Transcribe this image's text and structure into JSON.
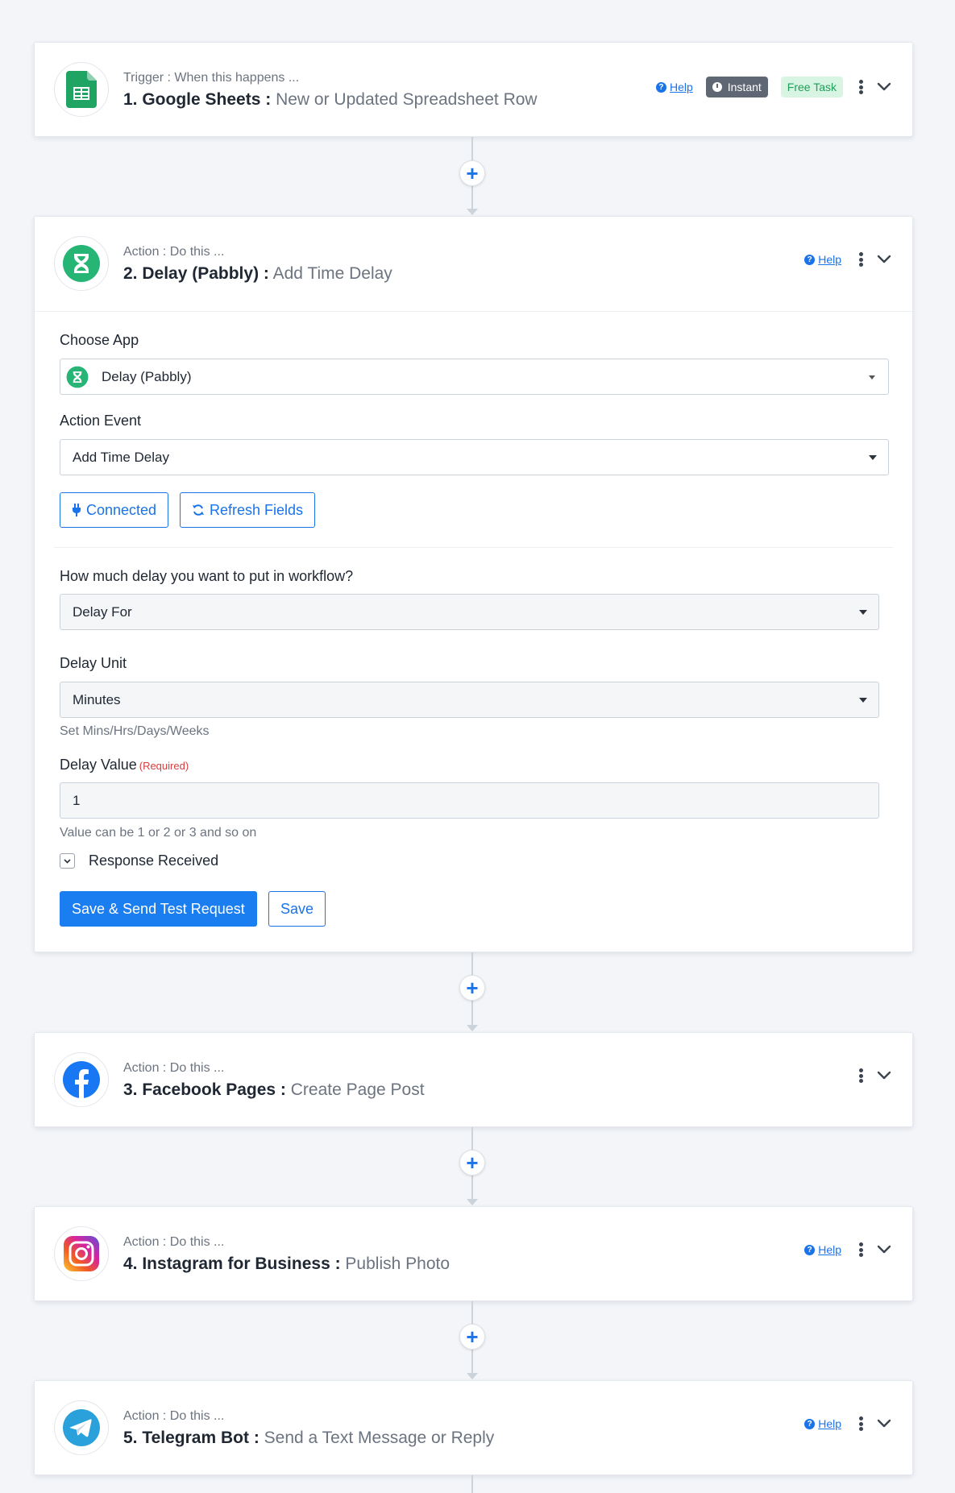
{
  "steps": [
    {
      "subtitle": "Trigger : When this happens ...",
      "app": "1. Google Sheets :",
      "event": "New or Updated Spreadsheet Row",
      "logo": "google-sheets-icon",
      "help": "Help",
      "instant": "Instant",
      "free_task": "Free Task"
    },
    {
      "subtitle": "Action : Do this ...",
      "app": "2. Delay (Pabbly) :",
      "event": "Add Time Delay",
      "logo": "hourglass-icon",
      "help": "Help"
    },
    {
      "subtitle": "Action : Do this ...",
      "app": "3. Facebook Pages :",
      "event": "Create Page Post",
      "logo": "facebook-icon"
    },
    {
      "subtitle": "Action : Do this ...",
      "app": "4. Instagram for Business :",
      "event": "Publish Photo",
      "logo": "instagram-icon",
      "help": "Help"
    },
    {
      "subtitle": "Action : Do this ...",
      "app": "5. Telegram Bot :",
      "event": "Send a Text Message or Reply",
      "logo": "telegram-icon",
      "help": "Help"
    }
  ],
  "delay_form": {
    "choose_app_label": "Choose App",
    "choose_app_value": "Delay (Pabbly)",
    "action_event_label": "Action Event",
    "action_event_value": "Add Time Delay",
    "connected_label": "Connected",
    "refresh_label": "Refresh Fields",
    "delay_question": "How much delay you want to put in workflow?",
    "delay_type_value": "Delay For",
    "delay_unit_label": "Delay Unit",
    "delay_unit_value": "Minutes",
    "delay_unit_hint": "Set Mins/Hrs/Days/Weeks",
    "delay_value_label": "Delay Value",
    "required_tag": "(Required)",
    "delay_value": "1",
    "delay_value_hint": "Value can be 1 or 2 or 3 and so on",
    "response_label": "Response Received",
    "save_test_label": "Save & Send Test Request",
    "save_label": "Save"
  },
  "colors": {
    "accent": "#1a73e8",
    "primary_button": "#1a7df0",
    "sheets_green": "#1fa463",
    "delay_green": "#26b574",
    "facebook_blue": "#1877f2",
    "telegram_blue": "#2aa1da"
  }
}
